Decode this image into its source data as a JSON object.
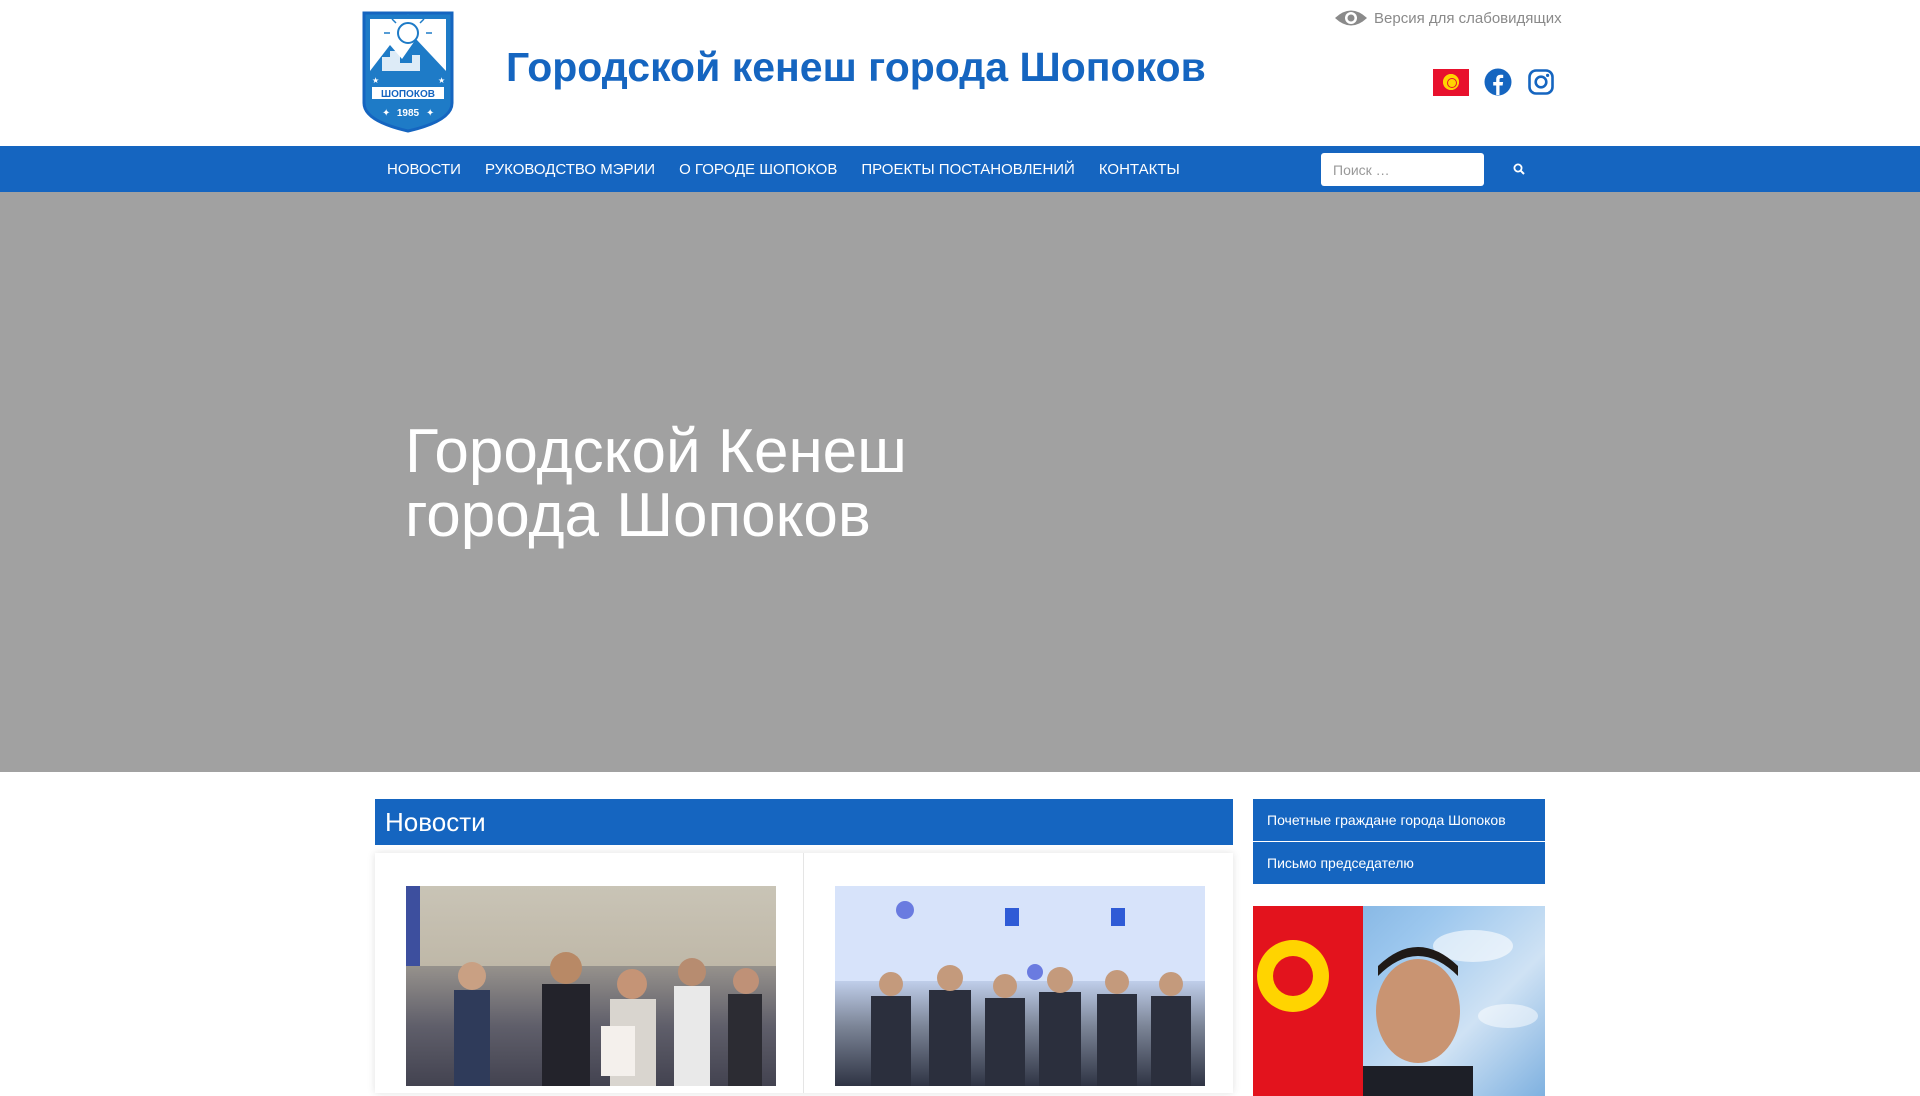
{
  "header": {
    "site_title": "Городской кенеш города Шопоков",
    "lowvision_label": "Версия для слабовидящих",
    "logo_text": "ШОПОКОВ",
    "logo_year": "1985"
  },
  "nav": {
    "items": [
      {
        "label": "Новости"
      },
      {
        "label": "Руководство мэрии"
      },
      {
        "label": "О городе Шопоков"
      },
      {
        "label": "Проекты постановлений"
      },
      {
        "label": "Контакты"
      }
    ],
    "search_placeholder": "Поиск …"
  },
  "hero": {
    "title_line1": "Городской Кенеш",
    "title_line2": "города Шопоков"
  },
  "news": {
    "header": "Новости"
  },
  "sidebar": {
    "buttons": [
      {
        "label": "Почетные граждане города Шопоков"
      },
      {
        "label": "Письмо председателю"
      }
    ]
  },
  "colors": {
    "brand_blue": "#1565c0",
    "hero_gray": "#a1a1a1"
  },
  "icons": [
    "eye-icon",
    "kyrgyz-flag-icon",
    "facebook-icon",
    "instagram-icon",
    "search-icon"
  ]
}
